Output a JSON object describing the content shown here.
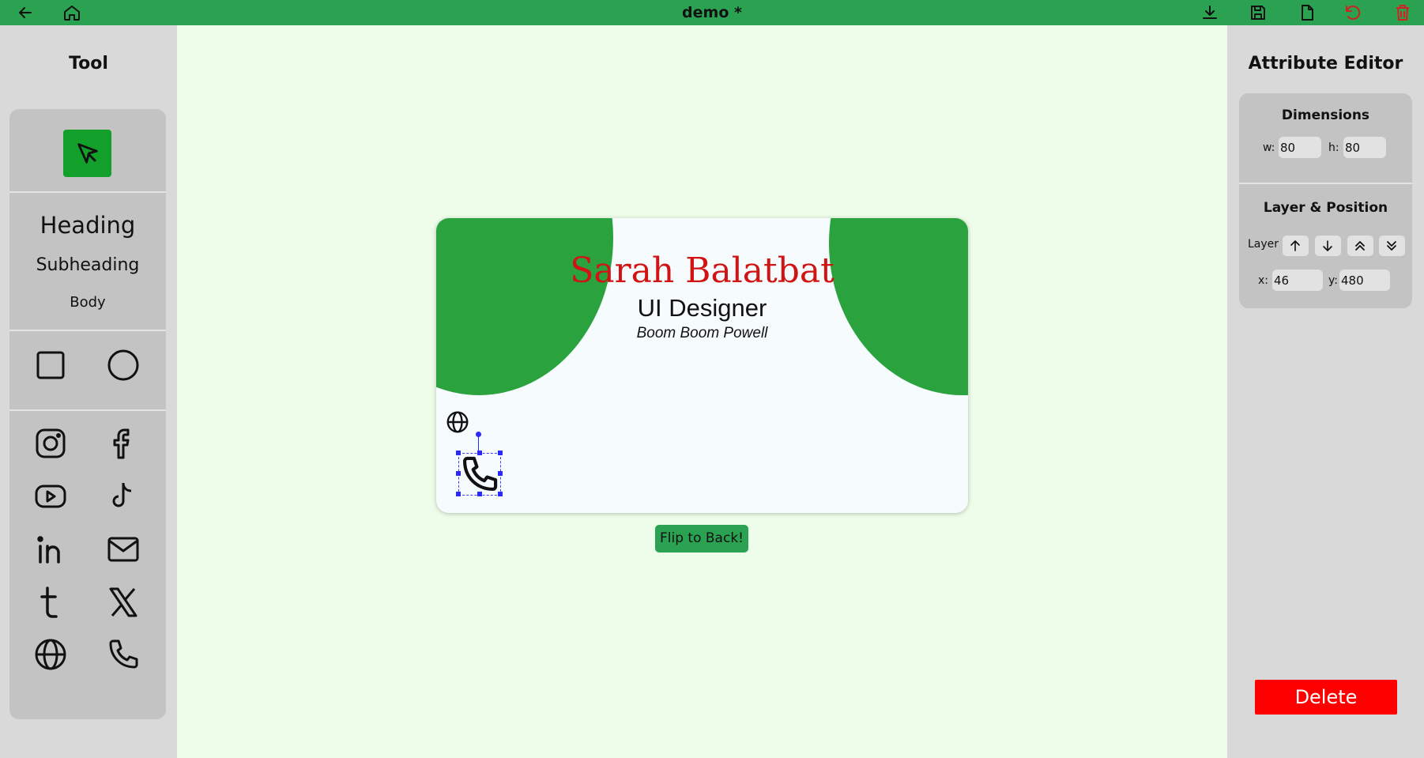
{
  "window": {
    "title": "demo *"
  },
  "topbar": {
    "icons": [
      "back-arrow-icon",
      "home-icon",
      "download-icon",
      "save-icon",
      "new-file-icon",
      "undo-icon",
      "trash-icon"
    ],
    "icon_color": "#111111",
    "danger_color": "#d42020"
  },
  "tool_panel": {
    "title": "Tool",
    "text_tools": {
      "heading": "Heading",
      "subheading": "Subheading",
      "body": "Body"
    },
    "shape_tools": [
      "square-icon",
      "circle-icon"
    ],
    "icon_tools": [
      "instagram-icon",
      "facebook-icon",
      "youtube-icon",
      "tiktok-icon",
      "linkedin-icon",
      "mail-icon",
      "tumblr-icon",
      "x-twitter-icon",
      "globe-icon",
      "phone-icon"
    ],
    "accent": "#12a02a"
  },
  "canvas": {
    "card": {
      "name": "Sarah Balatbat",
      "role": "UI Designer",
      "company": "Boom Boom Powell",
      "name_color": "#d11313",
      "accent": "#2aa23e",
      "elements": [
        "globe-icon",
        "phone-icon"
      ],
      "selected_element": "phone-icon"
    },
    "flip_button": "Flip to Back!"
  },
  "attribute_editor": {
    "title": "Attribute Editor",
    "dimensions": {
      "title": "Dimensions",
      "w_label": "w:",
      "w_value": "80",
      "h_label": "h:",
      "h_value": "80"
    },
    "layer_position": {
      "title": "Layer & Position",
      "layer_label": "Layer",
      "layer_buttons": [
        "arrow-up-icon",
        "arrow-down-icon",
        "double-arrow-up-icon",
        "double-arrow-down-icon"
      ],
      "x_label": "x:",
      "x_value": "46",
      "y_label": "y:",
      "y_value": "480"
    },
    "delete_button": "Delete",
    "delete_color": "#ff0000"
  }
}
